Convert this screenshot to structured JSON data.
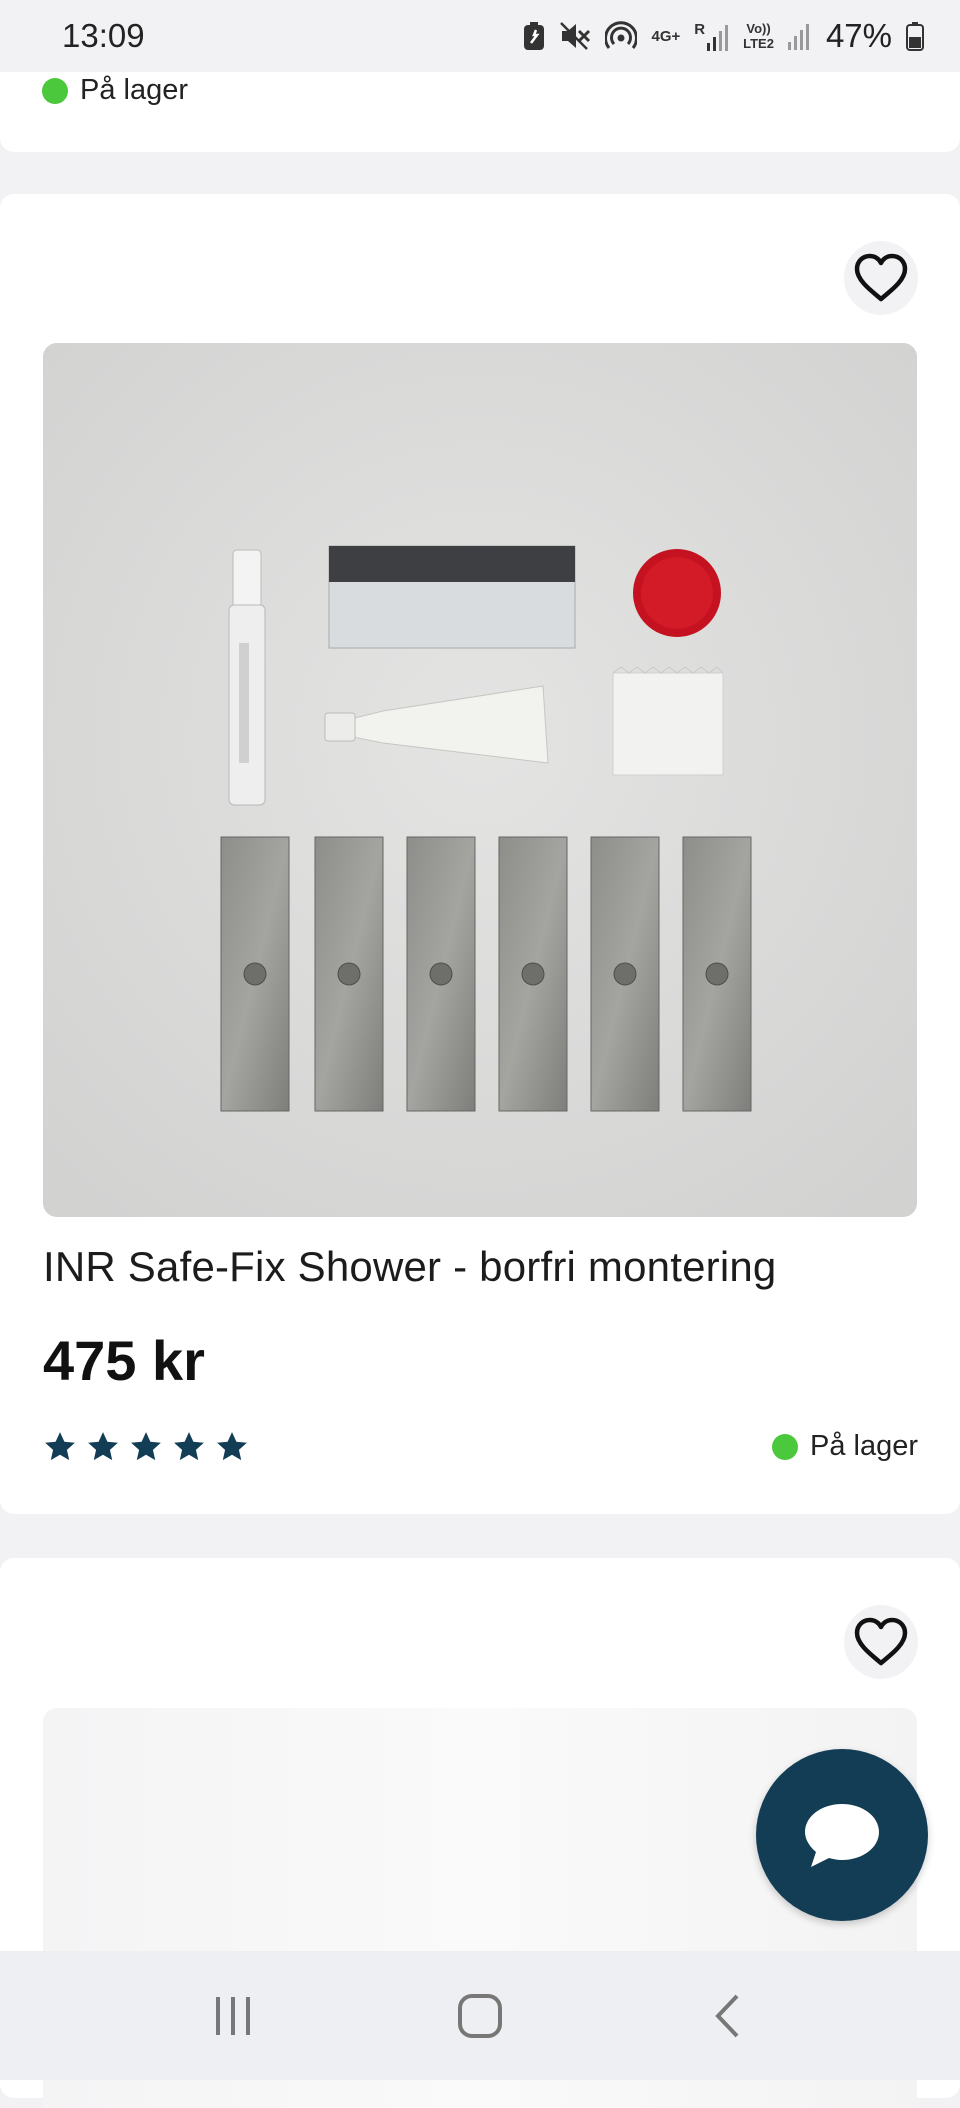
{
  "status_bar": {
    "time": "13:09",
    "network_1": "4G+",
    "network_2": "Vo))\nLTE2",
    "roaming": "R",
    "battery_percent": "47%"
  },
  "previous_product": {
    "stock_label": "På lager"
  },
  "product": {
    "title": "INR Safe-Fix Shower - borfri montering",
    "price": "475 kr",
    "rating_stars": 5,
    "stock_label": "På lager",
    "favorite_icon": "heart-outline-icon"
  },
  "next_product": {
    "favorite_icon": "heart-outline-icon"
  },
  "chat": {
    "icon": "chat-bubble-icon"
  },
  "nav_bar": {
    "recent_icon": "recent-apps-icon",
    "home_icon": "home-icon",
    "back_icon": "back-icon"
  },
  "colors": {
    "in_stock": "#4cc83c",
    "star": "#133d54",
    "chat_button": "#133d54"
  }
}
